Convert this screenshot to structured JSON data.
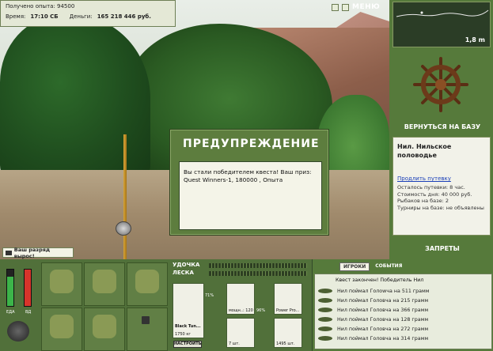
{
  "hud": {
    "exp_label": "Получено опыта: 94500",
    "time_label": "Время:",
    "time_value": "17:10 СБ",
    "money_label": "Деньги:",
    "money_value": "165 218 446 руб."
  },
  "top_menu": {
    "menu_label": "МЕНЮ"
  },
  "depth": {
    "value": "1,8 m"
  },
  "location": {
    "return_label": "ВЕРНУТЬСЯ НА БАЗУ",
    "name": "Нил. Нильское половодье",
    "extend_link": "Продлить путевку",
    "left": "Осталось путевки: 8 час.",
    "cost": "Стоимость дня: 40 000 руб.",
    "anglers": "Рыбаков на базе: 2",
    "tournaments": "Турниры на базе: не объявлены",
    "bans_label": "ЗАПРЕТЫ"
  },
  "rank_msg": "Ваш разряд вырос!",
  "modal": {
    "title": "ПРЕДУПРЕЖДЕНИЕ",
    "text": "Вы стали победителем квеста! Ваш приз: Quest Winners-1, 180000 , Опыта"
  },
  "gauges": {
    "food_label": "ЕДА",
    "food_level": 0.8,
    "sleep_label": "ВД",
    "sleep_level": 1.0
  },
  "gear": {
    "rod_label": "УДОЧКА",
    "line_label": "ЛЕСКА",
    "rod_name": "Black Tun...",
    "rod_weight": "1750 кг",
    "rod_pct": "71%",
    "reel_name": "мощн..: 120",
    "reel_pct": "96%",
    "bait_name": "Power Pro...",
    "hook_count": "7 шт.",
    "bait2_count": "1495 шт.",
    "setup_label": "НАСТРОИТЬ"
  },
  "events": {
    "tab_players": "ИГРОКИ",
    "tab_events": "СОБЫТИЯ",
    "header": "Квест закончен! Победитель Нил",
    "rows": [
      "Нил поймал Голowча на 511 грамм",
      "Нил поймал Головча на 215 грамм",
      "Нил поймал Головча на 366 грамм",
      "Нил поймал Головча на 128 грамм",
      "Нил поймал Головча на 272 грамм",
      "Нил поймал Головча на 314 грамм"
    ]
  },
  "colors": {
    "panel_green": "#567a3b",
    "frame_dark": "#33492a",
    "bar_food": "#3cb54a",
    "bar_sleep": "#d8342b"
  }
}
